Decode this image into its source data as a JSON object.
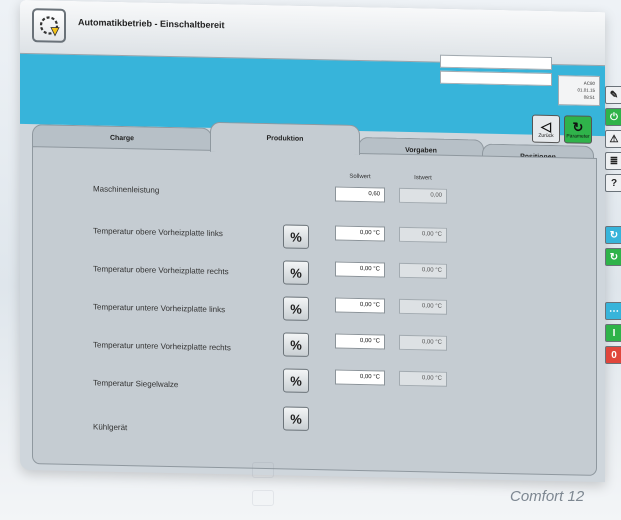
{
  "header": {
    "status_title": "Automatikbetrieb - Einschaltbereit",
    "info_lines": [
      "AC80",
      "01.01.15",
      "08:51"
    ]
  },
  "nav": {
    "back_label": "Zurück",
    "param_label": "Parameter"
  },
  "tabs": [
    {
      "label": "Charge",
      "active": false
    },
    {
      "label": "Produktion",
      "active": true
    },
    {
      "label": "Vorgaben",
      "active": false
    },
    {
      "label": "Positionen",
      "active": false
    }
  ],
  "columns": {
    "setpoint": "Sollwert",
    "actual": "Istwert"
  },
  "rows": [
    {
      "label": "Maschinenleistung",
      "setpoint": "0,60",
      "actual": "0,00",
      "has_pct": false
    },
    {
      "label": "Temperatur obere Vorheizplatte links",
      "setpoint": "0,00 °C",
      "actual": "0,00 °C",
      "has_pct": true
    },
    {
      "label": "Temperatur obere Vorheizplatte rechts",
      "setpoint": "0,00 °C",
      "actual": "0,00 °C",
      "has_pct": true
    },
    {
      "label": "Temperatur untere Vorheizplatte links",
      "setpoint": "0,00 °C",
      "actual": "0,00 °C",
      "has_pct": true
    },
    {
      "label": "Temperatur untere Vorheizplatte rechts",
      "setpoint": "0,00 °C",
      "actual": "0,00 °C",
      "has_pct": true
    },
    {
      "label": "Temperatur Siegelwalze",
      "setpoint": "0,00 °C",
      "actual": "0,00 °C",
      "has_pct": true
    },
    {
      "label": "Kühlgerät",
      "setpoint": "",
      "actual": "",
      "has_pct": true
    }
  ],
  "pct_symbol": "%",
  "model_label": "Comfort 12",
  "colors": {
    "accent_blue": "#37b4da",
    "green_button": "#2fb34a",
    "red_button": "#e0463c"
  }
}
